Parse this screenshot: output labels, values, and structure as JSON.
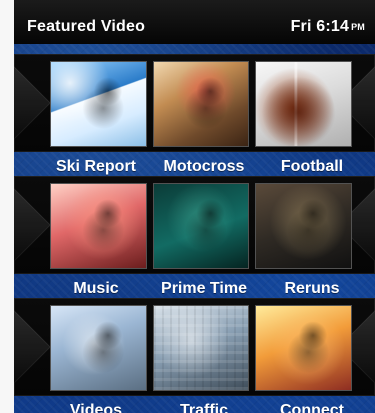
{
  "status_bar": {
    "title": "Featured Video",
    "time": "Fri 6:14",
    "ampm": "PM"
  },
  "grid": {
    "rows": [
      {
        "items": [
          {
            "label": "Ski Report"
          },
          {
            "label": "Motocross"
          },
          {
            "label": "Football"
          }
        ]
      },
      {
        "items": [
          {
            "label": "Music"
          },
          {
            "label": "Prime Time"
          },
          {
            "label": "Reruns"
          }
        ]
      },
      {
        "items": [
          {
            "label": "Videos"
          },
          {
            "label": "Traffic"
          },
          {
            "label": "Connect"
          }
        ]
      }
    ]
  }
}
